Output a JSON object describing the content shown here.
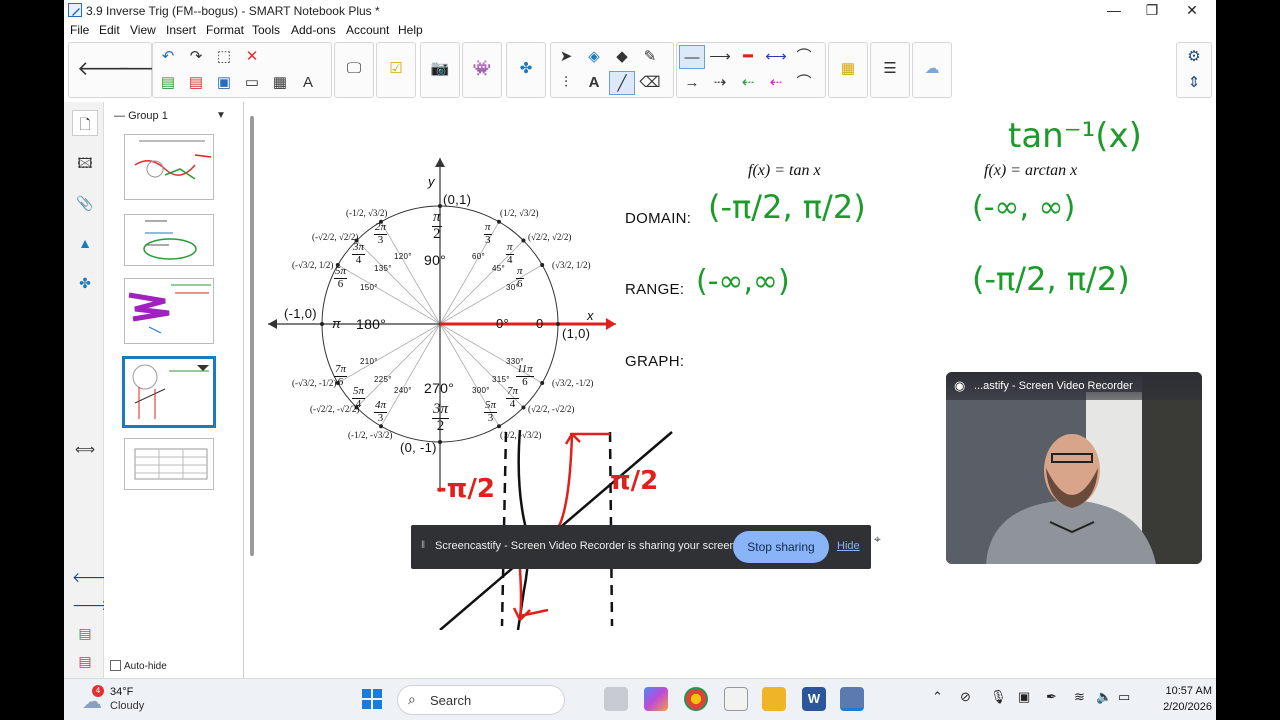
{
  "window": {
    "title": "3.9 Inverse Trig (FM--bogus) - SMART Notebook Plus *",
    "minimize": "—",
    "maximize": "❐",
    "close": "✕"
  },
  "menu": [
    "File",
    "Edit",
    "View",
    "Insert",
    "Format",
    "Tools",
    "Add-ons",
    "Account",
    "Help"
  ],
  "sorter": {
    "group_label": "Group 1",
    "pages": [
      "1",
      "2",
      "3",
      "4",
      "5"
    ],
    "selected_page": "4",
    "autohide_label": "Auto-hide"
  },
  "unit_circle": {
    "axis_x": "x",
    "axis_y": "y",
    "point_top": "(0,1)",
    "point_bottom": "(0, -1)",
    "point_left": "(-1,0)",
    "point_right": "(1,0)",
    "deg_90": "90°",
    "deg_180": "180°",
    "deg_270": "270°",
    "deg_0": "0°",
    "rad_0": "0",
    "rad_pi": "π",
    "small_degrees": [
      "30°",
      "45°",
      "60°",
      "120°",
      "135°",
      "150°",
      "210°",
      "225°",
      "240°",
      "300°",
      "315°",
      "330°"
    ],
    "radians": [
      {
        "num": "π",
        "den": "2"
      },
      {
        "num": "π",
        "den": "3"
      },
      {
        "num": "π",
        "den": "4"
      },
      {
        "num": "π",
        "den": "6"
      },
      {
        "num": "2π",
        "den": "3"
      },
      {
        "num": "3π",
        "den": "4"
      },
      {
        "num": "5π",
        "den": "6"
      },
      {
        "num": "7π",
        "den": "6"
      },
      {
        "num": "5π",
        "den": "4"
      },
      {
        "num": "4π",
        "den": "3"
      },
      {
        "num": "3π",
        "den": "2"
      },
      {
        "num": "5π",
        "den": "3"
      },
      {
        "num": "7π",
        "den": "4"
      },
      {
        "num": "11π",
        "den": "6"
      }
    ],
    "coords": [
      "(1/2, √3/2)",
      "(√2/2, √2/2)",
      "(√3/2, 1/2)",
      "(-1/2, √3/2)",
      "(-√2/2, √2/2)",
      "(-√3/2, 1/2)",
      "(-√3/2, -1/2)",
      "(-√2/2, -√2/2)",
      "(-1/2, -√3/2)",
      "(1/2, -√3/2)",
      "(√2/2, -√2/2)",
      "(√3/2, -1/2)"
    ]
  },
  "lesson": {
    "fx_tan": "f(x) = tan x",
    "fx_arctan": "f(x) = arctan x",
    "handwritten_title": "tan⁻¹(x)",
    "domain_label": "DOMAIN:",
    "range_label": "RANGE:",
    "graph_label": "GRAPH:",
    "tan_domain": "(-π/2, π/2)",
    "tan_range": "(-∞,∞)",
    "arctan_domain": "(-∞, ∞)",
    "arctan_range": "(-π/2, π/2)",
    "graph_left_label": "-π/2",
    "graph_right_label": "π/2"
  },
  "webcam": {
    "title": "...astify - Screen Video Recorder"
  },
  "share_bar": {
    "message": "Screencastify - Screen Video Recorder is sharing your screen.",
    "stop_label": "Stop sharing",
    "hide_label": "Hide"
  },
  "taskbar": {
    "weather_temp": "34°F",
    "weather_cond": "Cloudy",
    "weather_badge": "4",
    "search_label": "Search",
    "time": "10:57 AM",
    "date": "2/20/2026"
  },
  "colors": {
    "handwriting_green": "#1a9b2a",
    "handwriting_red": "#e0201a",
    "selection_blue": "#1a7bbf"
  }
}
